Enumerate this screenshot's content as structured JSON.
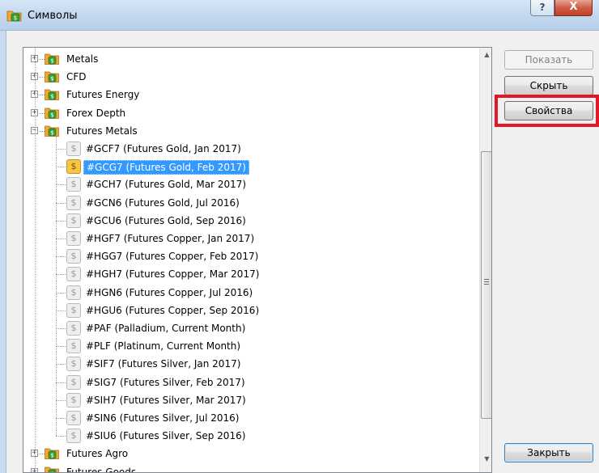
{
  "window": {
    "title": "Символы",
    "help_label": "?",
    "close_label": "X"
  },
  "tree": {
    "groups_top": [
      {
        "label": "Metals",
        "expanded": false
      },
      {
        "label": "CFD",
        "expanded": false
      },
      {
        "label": "Futures Energy",
        "expanded": false
      },
      {
        "label": "Forex Depth",
        "expanded": false
      },
      {
        "label": "Futures Metals",
        "expanded": true
      }
    ],
    "symbols": [
      {
        "label": "#GCF7  (Futures Gold, Jan 2017)",
        "selected": false
      },
      {
        "label": "#GCG7  (Futures Gold, Feb 2017)",
        "selected": true
      },
      {
        "label": "#GCH7  (Futures Gold, Mar 2017)",
        "selected": false
      },
      {
        "label": "#GCN6  (Futures Gold, Jul 2016)",
        "selected": false
      },
      {
        "label": "#GCU6  (Futures Gold, Sep 2016)",
        "selected": false
      },
      {
        "label": "#HGF7  (Futures Copper, Jan 2017)",
        "selected": false
      },
      {
        "label": "#HGG7  (Futures Copper, Feb 2017)",
        "selected": false
      },
      {
        "label": "#HGH7  (Futures Copper, Mar 2017)",
        "selected": false
      },
      {
        "label": "#HGN6  (Futures Copper, Jul 2016)",
        "selected": false
      },
      {
        "label": "#HGU6  (Futures Copper, Sep 2016)",
        "selected": false
      },
      {
        "label": "#PAF  (Palladium, Current Month)",
        "selected": false
      },
      {
        "label": "#PLF  (Platinum, Current Month)",
        "selected": false
      },
      {
        "label": "#SIF7  (Futures Silver, Jan 2017)",
        "selected": false
      },
      {
        "label": "#SIG7  (Futures Silver, Feb 2017)",
        "selected": false
      },
      {
        "label": "#SIH7  (Futures Silver, Mar 2017)",
        "selected": false
      },
      {
        "label": "#SIN6  (Futures Silver, Jul 2016)",
        "selected": false
      },
      {
        "label": "#SIU6  (Futures Silver, Sep 2016)",
        "selected": false
      }
    ],
    "groups_bottom": [
      {
        "label": "Futures Agro",
        "expanded": false
      },
      {
        "label": "Futures Goods",
        "expanded": false
      }
    ],
    "symbol_glyph": "$",
    "expand_glyph": "+",
    "collapse_glyph": "−"
  },
  "buttons": {
    "show": "Показать",
    "hide": "Скрыть",
    "properties": "Свойства",
    "close": "Закрыть"
  },
  "colors": {
    "selection": "#3399ff",
    "highlight_frame": "#e0182a",
    "folder_green": "#3aa23a",
    "folder_orange": "#f0a830"
  }
}
